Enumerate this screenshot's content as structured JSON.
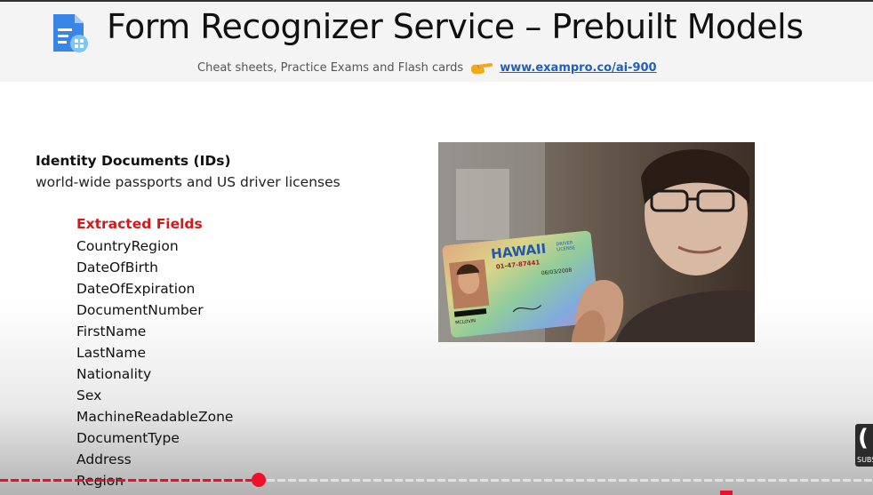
{
  "header": {
    "title": "Form Recognizer Service – Prebuilt Models",
    "subtitle": "Cheat sheets, Practice Exams and Flash cards",
    "link": "www.exampro.co/ai-900",
    "icon": "form-document-icon",
    "pointer_icon": "pointing-hand-icon"
  },
  "content": {
    "heading": "Identity Documents (IDs)",
    "description": "world-wide passports and US driver licenses",
    "fields_heading": "Extracted Fields",
    "fields": [
      "CountryRegion",
      "DateOfBirth",
      "DateOfExpiration",
      "DocumentNumber",
      "FirstName",
      "LastName",
      "Nationality",
      "Sex",
      "MachineReadableZone",
      "DocumentType",
      "Address",
      "Region"
    ]
  },
  "photo": {
    "card_state": "HAWAII",
    "card_label_1": "DRIVER",
    "card_label_2": "LICENSE",
    "card_number": "01-47-87441",
    "card_date": "06/03/2008",
    "card_name": "MCLOVIN"
  },
  "player": {
    "progress": 0.296,
    "subscribe_glyph": "(",
    "subscribe_text": "SUBSCRIBE"
  },
  "colors": {
    "accent_red": "#d11a1a",
    "link_blue": "#1f5fbf",
    "progress_red": "#e8102a"
  }
}
